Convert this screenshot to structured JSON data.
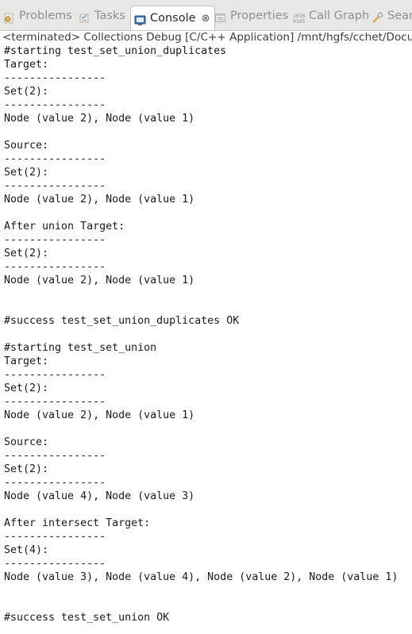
{
  "tabs": [
    {
      "label": "Problems",
      "icon": "problems-icon",
      "active": false
    },
    {
      "label": "Tasks",
      "icon": "tasks-icon",
      "active": false
    },
    {
      "label": "Console",
      "icon": "console-icon",
      "active": true
    },
    {
      "label": "Properties",
      "icon": "properties-icon",
      "active": false
    },
    {
      "label": "Call Graph",
      "icon": "call-graph-icon",
      "active": false
    },
    {
      "label": "Searc",
      "icon": "search-icon",
      "active": false
    }
  ],
  "console_close_glyph": "⊗",
  "status": "<terminated> Collections Debug [C/C++ Application] /mnt/hgfs/cchet/Docum",
  "console_lines": [
    "#starting test_set_union_duplicates",
    "Target:",
    "----------------",
    "Set(2):",
    "----------------",
    "Node (value 2), Node (value 1)",
    "",
    "Source:",
    "----------------",
    "Set(2):",
    "----------------",
    "Node (value 2), Node (value 1)",
    "",
    "After union Target:",
    "----------------",
    "Set(2):",
    "----------------",
    "Node (value 2), Node (value 1)",
    "",
    "",
    "#success test_set_union_duplicates OK",
    "",
    "#starting test_set_union",
    "Target:",
    "----------------",
    "Set(2):",
    "----------------",
    "Node (value 2), Node (value 1)",
    "",
    "Source:",
    "----------------",
    "Set(2):",
    "----------------",
    "Node (value 4), Node (value 3)",
    "",
    "After intersect Target:",
    "----------------",
    "Set(4):",
    "----------------",
    "Node (value 3), Node (value 4), Node (value 2), Node (value 1)",
    "",
    "",
    "#success test_set_union OK"
  ],
  "colors": {
    "tabbar_bg": "#e8e8e7",
    "active_tab_bg": "#ffffff",
    "inactive_text": "#8f8f8f",
    "console_text": "#1a1a1a"
  }
}
